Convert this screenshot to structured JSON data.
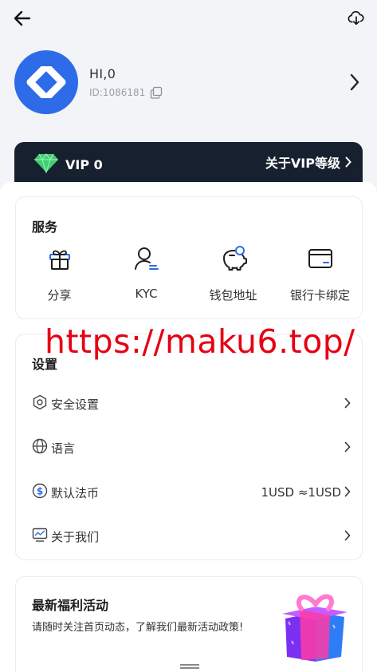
{
  "header": {
    "back_icon": "arrow-left-icon",
    "download_icon": "download-icon"
  },
  "profile": {
    "name": "HI,0",
    "id_text": "ID:1086181"
  },
  "vip": {
    "label": "VIP 0",
    "link": "关于VIP等级"
  },
  "services": {
    "title": "服务",
    "items": [
      {
        "label": "分享",
        "icon": "gift-icon"
      },
      {
        "label": "KYC",
        "icon": "user-verify-icon"
      },
      {
        "label": "钱包地址",
        "icon": "piggy-bank-icon"
      },
      {
        "label": "银行卡绑定",
        "icon": "bank-card-icon"
      }
    ]
  },
  "settings": {
    "title": "设置",
    "items": [
      {
        "label": "安全设置",
        "icon": "hexagon-shield-icon",
        "value": ""
      },
      {
        "label": "语言",
        "icon": "globe-icon",
        "value": ""
      },
      {
        "label": "默认法币",
        "icon": "dollar-icon",
        "value": "1USD ≈1USD"
      },
      {
        "label": "关于我们",
        "icon": "monitor-chart-icon",
        "value": ""
      }
    ]
  },
  "watermark": "https://maku6.top/",
  "promo": {
    "title": "最新福利活动",
    "subtitle": "请随时关注首页动态，了解我们最新活动政策!"
  },
  "colors": {
    "accent": "#2d6be8",
    "vip_bg": "#17202e",
    "watermark": "#e60012",
    "diamond": "#3ecf6e"
  }
}
